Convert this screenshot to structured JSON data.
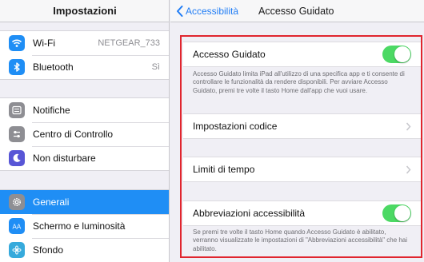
{
  "left_pane": {
    "title": "Impostazioni",
    "group1": [
      {
        "icon": "wifi-icon",
        "label": "Wi-Fi",
        "value": "NETGEAR_733",
        "color": "#1f8ef5"
      },
      {
        "icon": "bluetooth-icon",
        "label": "Bluetooth",
        "value": "Sì",
        "color": "#1f8ef5"
      }
    ],
    "group2": [
      {
        "icon": "notifications-icon",
        "label": "Notifiche",
        "color": "#8e8e93"
      },
      {
        "icon": "control-center-icon",
        "label": "Centro di Controllo",
        "color": "#8e8e93"
      },
      {
        "icon": "moon-icon",
        "label": "Non disturbare",
        "color": "#5856d6"
      }
    ],
    "group3": [
      {
        "icon": "gear-icon",
        "label": "Generali",
        "color": "#8e8e93",
        "selected": true
      },
      {
        "icon": "display-brightness-icon",
        "label": "Schermo e luminosità",
        "color": "#1f8ef5"
      },
      {
        "icon": "wallpaper-icon",
        "label": "Sfondo",
        "color": "#36aadc"
      }
    ]
  },
  "right_pane": {
    "back_label": "Accessibilità",
    "title": "Accesso Guidato",
    "guided_access": {
      "label": "Accesso Guidato",
      "enabled": true
    },
    "guided_access_description": "Accesso Guidato limita iPad all'utilizzo di una specifica app e ti consente di controllare le funzionalità da rendere disponibili. Per avviare Accesso Guidato, premi tre volte il tasto Home dall'app che vuoi usare.",
    "passcode_settings_label": "Impostazioni codice",
    "time_limits_label": "Limiti di tempo",
    "accessibility_shortcut": {
      "label": "Abbreviazioni accessibilità",
      "enabled": true
    },
    "accessibility_shortcut_description": "Se premi tre volte il tasto Home quando Accesso Guidato è abilitato, verranno visualizzate le impostazioni di \"Abbreviazioni accessibilità\" che hai abilitato."
  },
  "colors": {
    "accent": "#1f7cf5",
    "selected_row": "#1f8ef5",
    "toggle_on": "#4cd964",
    "highlight_border": "#e0252e"
  }
}
